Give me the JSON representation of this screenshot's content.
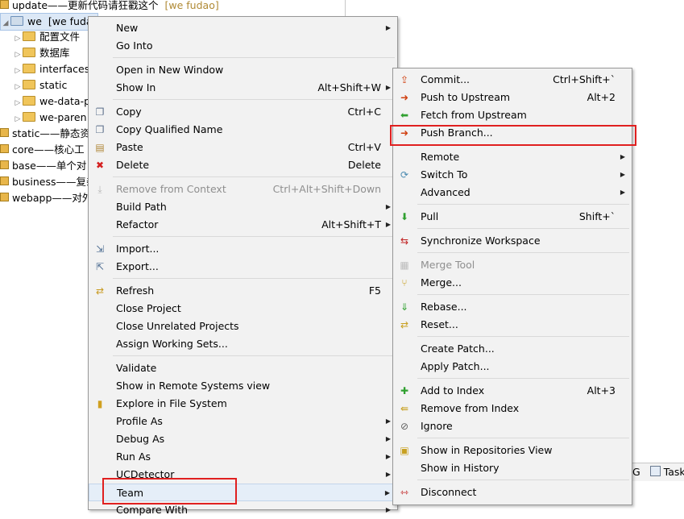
{
  "tree": {
    "rows": [
      {
        "name": "update",
        "desc": "——更新代码请狂戳这个",
        "ann": "[we fudao]"
      },
      {
        "name": "we",
        "desc": "[we fuda",
        "ann": ""
      },
      {
        "name": "配置文件",
        "desc": "",
        "ann": ""
      },
      {
        "name": "数据库",
        "desc": "",
        "ann": ""
      },
      {
        "name": "interfaces",
        "desc": "",
        "ann": ""
      },
      {
        "name": "static",
        "desc": "",
        "ann": ""
      },
      {
        "name": "we-data-p",
        "desc": "",
        "ann": ""
      },
      {
        "name": "we-paren",
        "desc": "",
        "ann": ""
      },
      {
        "name": "static",
        "desc": "——静态资",
        "ann": ""
      },
      {
        "name": "core",
        "desc": "——核心工",
        "ann": ""
      },
      {
        "name": "base",
        "desc": "——单个对",
        "ann": ""
      },
      {
        "name": "business",
        "desc": "——复杂",
        "ann": ""
      },
      {
        "name": "webapp",
        "desc": "——对外",
        "ann": ""
      }
    ]
  },
  "bottom_tabs": {
    "tab1": "G",
    "tab2": "Task"
  },
  "context_menu": {
    "items": [
      {
        "label": "New",
        "shortcut": "",
        "submenu": true,
        "icon": ""
      },
      {
        "label": "Go Into",
        "shortcut": "",
        "submenu": false,
        "icon": ""
      },
      {
        "label": "Open in New Window",
        "shortcut": "",
        "submenu": false,
        "icon": ""
      },
      {
        "label": "Show In",
        "shortcut": "Alt+Shift+W",
        "submenu": true,
        "icon": ""
      },
      {
        "label": "Copy",
        "shortcut": "Ctrl+C",
        "submenu": false,
        "icon": "copy-icon"
      },
      {
        "label": "Copy Qualified Name",
        "shortcut": "",
        "submenu": false,
        "icon": "copy-qualified-icon"
      },
      {
        "label": "Paste",
        "shortcut": "Ctrl+V",
        "submenu": false,
        "icon": "paste-icon"
      },
      {
        "label": "Delete",
        "shortcut": "Delete",
        "submenu": false,
        "icon": "delete-icon"
      },
      {
        "label": "Remove from Context",
        "shortcut": "Ctrl+Alt+Shift+Down",
        "submenu": false,
        "icon": "remove-context-icon",
        "disabled": true
      },
      {
        "label": "Build Path",
        "shortcut": "",
        "submenu": true,
        "icon": ""
      },
      {
        "label": "Refactor",
        "shortcut": "Alt+Shift+T",
        "submenu": true,
        "icon": ""
      },
      {
        "label": "Import...",
        "shortcut": "",
        "submenu": false,
        "icon": "import-icon"
      },
      {
        "label": "Export...",
        "shortcut": "",
        "submenu": false,
        "icon": "export-icon"
      },
      {
        "label": "Refresh",
        "shortcut": "F5",
        "submenu": false,
        "icon": "refresh-icon"
      },
      {
        "label": "Close Project",
        "shortcut": "",
        "submenu": false,
        "icon": ""
      },
      {
        "label": "Close Unrelated Projects",
        "shortcut": "",
        "submenu": false,
        "icon": ""
      },
      {
        "label": "Assign Working Sets...",
        "shortcut": "",
        "submenu": false,
        "icon": ""
      },
      {
        "label": "Validate",
        "shortcut": "",
        "submenu": false,
        "icon": ""
      },
      {
        "label": "Show in Remote Systems view",
        "shortcut": "",
        "submenu": false,
        "icon": ""
      },
      {
        "label": "Explore in File System",
        "shortcut": "",
        "submenu": false,
        "icon": "explore-icon"
      },
      {
        "label": "Profile As",
        "shortcut": "",
        "submenu": true,
        "icon": ""
      },
      {
        "label": "Debug As",
        "shortcut": "",
        "submenu": true,
        "icon": ""
      },
      {
        "label": "Run As",
        "shortcut": "",
        "submenu": true,
        "icon": ""
      },
      {
        "label": "UCDetector",
        "shortcut": "",
        "submenu": true,
        "icon": ""
      },
      {
        "label": "Team",
        "shortcut": "",
        "submenu": true,
        "icon": ""
      },
      {
        "label": "Compare With",
        "shortcut": "",
        "submenu": true,
        "icon": ""
      }
    ]
  },
  "team_submenu": {
    "items": [
      {
        "label": "Commit...",
        "shortcut": "Ctrl+Shift+`",
        "submenu": false,
        "icon": "commit-icon"
      },
      {
        "label": "Push to Upstream",
        "shortcut": "Alt+2",
        "submenu": false,
        "icon": "push-upstream-icon"
      },
      {
        "label": "Fetch from Upstream",
        "shortcut": "",
        "submenu": false,
        "icon": "fetch-upstream-icon"
      },
      {
        "label": "Push Branch...",
        "shortcut": "",
        "submenu": false,
        "icon": "push-branch-icon"
      },
      {
        "label": "Remote",
        "shortcut": "",
        "submenu": true,
        "icon": ""
      },
      {
        "label": "Switch To",
        "shortcut": "",
        "submenu": true,
        "icon": "switch-icon"
      },
      {
        "label": "Advanced",
        "shortcut": "",
        "submenu": true,
        "icon": ""
      },
      {
        "label": "Pull",
        "shortcut": "Shift+`",
        "submenu": false,
        "icon": "pull-icon"
      },
      {
        "label": "Synchronize Workspace",
        "shortcut": "",
        "submenu": false,
        "icon": "sync-icon"
      },
      {
        "label": "Merge Tool",
        "shortcut": "",
        "submenu": false,
        "icon": "merge-tool-icon",
        "disabled": true
      },
      {
        "label": "Merge...",
        "shortcut": "",
        "submenu": false,
        "icon": "merge-icon"
      },
      {
        "label": "Rebase...",
        "shortcut": "",
        "submenu": false,
        "icon": "rebase-icon"
      },
      {
        "label": "Reset...",
        "shortcut": "",
        "submenu": false,
        "icon": "reset-icon"
      },
      {
        "label": "Create Patch...",
        "shortcut": "",
        "submenu": false,
        "icon": ""
      },
      {
        "label": "Apply Patch...",
        "shortcut": "",
        "submenu": false,
        "icon": ""
      },
      {
        "label": "Add to Index",
        "shortcut": "Alt+3",
        "submenu": false,
        "icon": "add-index-icon"
      },
      {
        "label": "Remove from Index",
        "shortcut": "",
        "submenu": false,
        "icon": "remove-index-icon"
      },
      {
        "label": "Ignore",
        "shortcut": "",
        "submenu": false,
        "icon": "ignore-icon"
      },
      {
        "label": "Show in Repositories View",
        "shortcut": "",
        "submenu": false,
        "icon": "repositories-icon"
      },
      {
        "label": "Show in History",
        "shortcut": "",
        "submenu": false,
        "icon": ""
      },
      {
        "label": "Disconnect",
        "shortcut": "",
        "submenu": false,
        "icon": "disconnect-icon"
      }
    ]
  },
  "colors": {
    "menu_bg": "#f2f2f2",
    "highlight": "#e02020",
    "annotation": "#b08a34"
  }
}
